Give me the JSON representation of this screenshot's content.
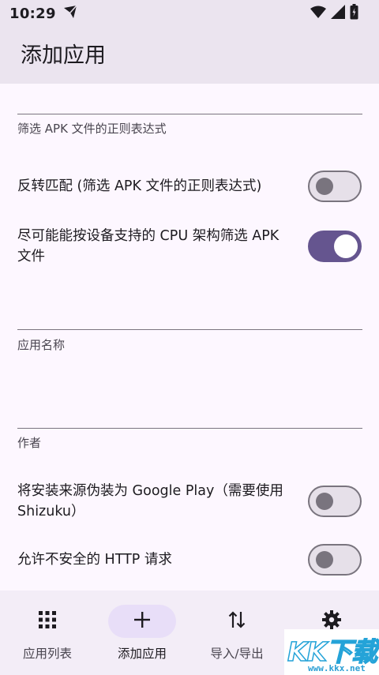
{
  "status_bar": {
    "time": "10:29"
  },
  "app_bar": {
    "title": "添加应用"
  },
  "form": {
    "apk_filter_label": "筛选 APK 文件的正则表达式",
    "invert_filter_label": "反转匹配 (筛选 APK 文件的正则表达式)",
    "invert_filter_on": false,
    "cpu_filter_label": "尽可能能按设备支持的 CPU 架构筛选 APK 文件",
    "cpu_filter_on": true,
    "app_name_label": "应用名称",
    "author_label": "作者",
    "fake_google_play_label": "将安装来源伪装为 Google Play（需要使用 Shizuku）",
    "fake_google_play_on": false,
    "allow_http_label": "允许不安全的 HTTP 请求",
    "allow_http_on": false
  },
  "bottom_nav": {
    "items": [
      {
        "label": "应用列表",
        "icon": "apps-grid-icon",
        "active": false
      },
      {
        "label": "添加应用",
        "icon": "add-icon",
        "active": true
      },
      {
        "label": "导入/导出",
        "icon": "import-export-icon",
        "active": false
      },
      {
        "label": "设置",
        "icon": "settings-icon",
        "active": false
      }
    ]
  },
  "watermark": {
    "brand": "KK下载",
    "url": "www.kkx.net"
  },
  "colors": {
    "top_bar": "#ebe4ef",
    "background": "#fdf7ff",
    "primary": "#65558f",
    "nav_active": "#e8def8"
  }
}
